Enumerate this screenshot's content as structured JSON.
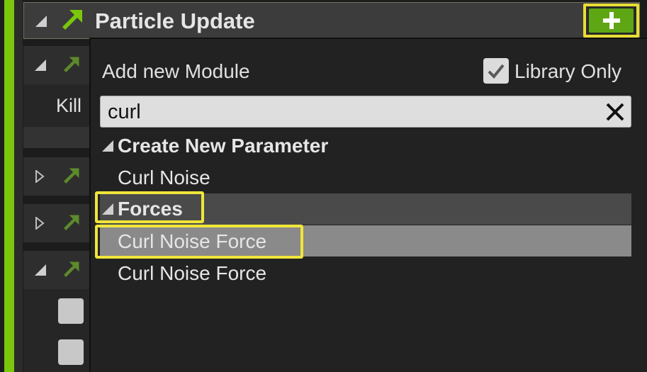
{
  "stack": {
    "title": "Particle Update",
    "add_button_icon": "plus-icon"
  },
  "left_panel": {
    "kill_label": "Kill"
  },
  "popup": {
    "title": "Add new Module",
    "library_only_label": "Library Only",
    "library_only_checked": true,
    "search_value": "curl",
    "categories": [
      {
        "label": "Create New Parameter",
        "items": [
          "Curl Noise"
        ]
      },
      {
        "label": "Forces",
        "items": [
          "Curl Noise Force",
          "Curl Noise Force"
        ]
      }
    ],
    "selected_item": "Curl Noise Force"
  },
  "colors": {
    "accent_green": "#7ac70c",
    "add_button_green": "#5fa614",
    "highlight_yellow": "#f0e53a",
    "selected_row": "#8a8a8a",
    "category_row": "#4a4a4a"
  }
}
